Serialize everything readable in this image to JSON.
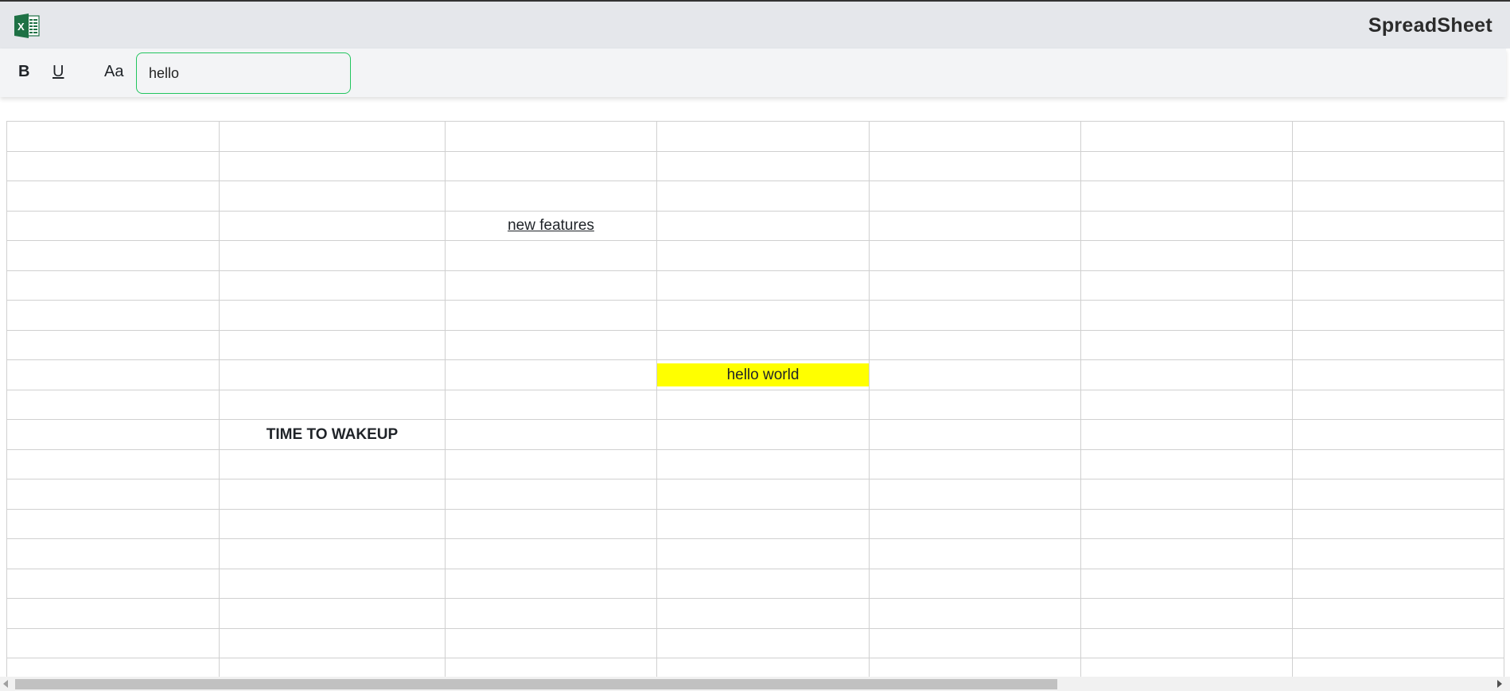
{
  "header": {
    "title": "SpreadSheet",
    "logo_icon": "excel-icon"
  },
  "toolbar": {
    "bold_label": "B",
    "underline_label": "U",
    "font_label": "Aa",
    "cell_input_value": "hello"
  },
  "grid": {
    "row_count": 19,
    "column_count": 7,
    "cells": [
      {
        "row": 3,
        "col": 2,
        "text": "new features",
        "underline": true
      },
      {
        "row": 8,
        "col": 3,
        "text": "hello world",
        "background": "#ffff00"
      },
      {
        "row": 10,
        "col": 1,
        "text": "TIME TO WAKEUP",
        "bold": true
      }
    ]
  },
  "colors": {
    "accent": "#22c55e",
    "header_bg": "#e5e7eb",
    "toolbar_bg": "#f3f4f6"
  }
}
